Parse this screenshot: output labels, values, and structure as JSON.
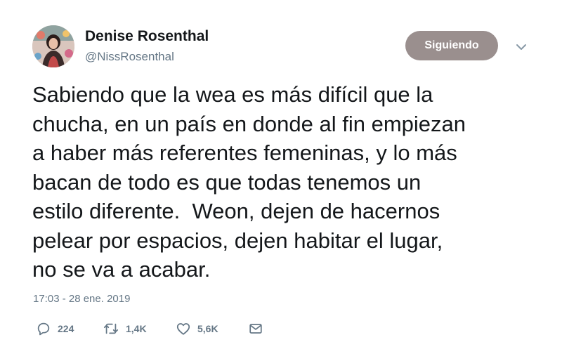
{
  "author": {
    "name": "Denise Rosenthal",
    "handle": "@NissRosenthal",
    "avatar_icon": "profile-photo"
  },
  "follow_button": {
    "label": "Siguiendo",
    "color": "#9a8f8e"
  },
  "menu": {
    "icon": "chevron-down-icon"
  },
  "tweet": {
    "text": "Sabiendo que la wea es más difícil que la\nchucha, en un país en donde al fin empiezan\na haber más referentes femeninas, y lo más\nbacan de todo es que todas tenemos un\nestilo diferente.  Weon, dejen de hacernos\npelear por espacios, dejen habitar el lugar,\nno se va a acabar.",
    "timestamp": "17:03 - 28 ene. 2019"
  },
  "actions": {
    "replies": {
      "icon": "reply-icon",
      "count": "224"
    },
    "retweets": {
      "icon": "retweet-icon",
      "count": "1,4K"
    },
    "likes": {
      "icon": "heart-icon",
      "count": "5,6K"
    },
    "message": {
      "icon": "envelope-icon"
    }
  },
  "colors": {
    "text": "#14171a",
    "secondary": "#657786",
    "background": "#ffffff"
  }
}
